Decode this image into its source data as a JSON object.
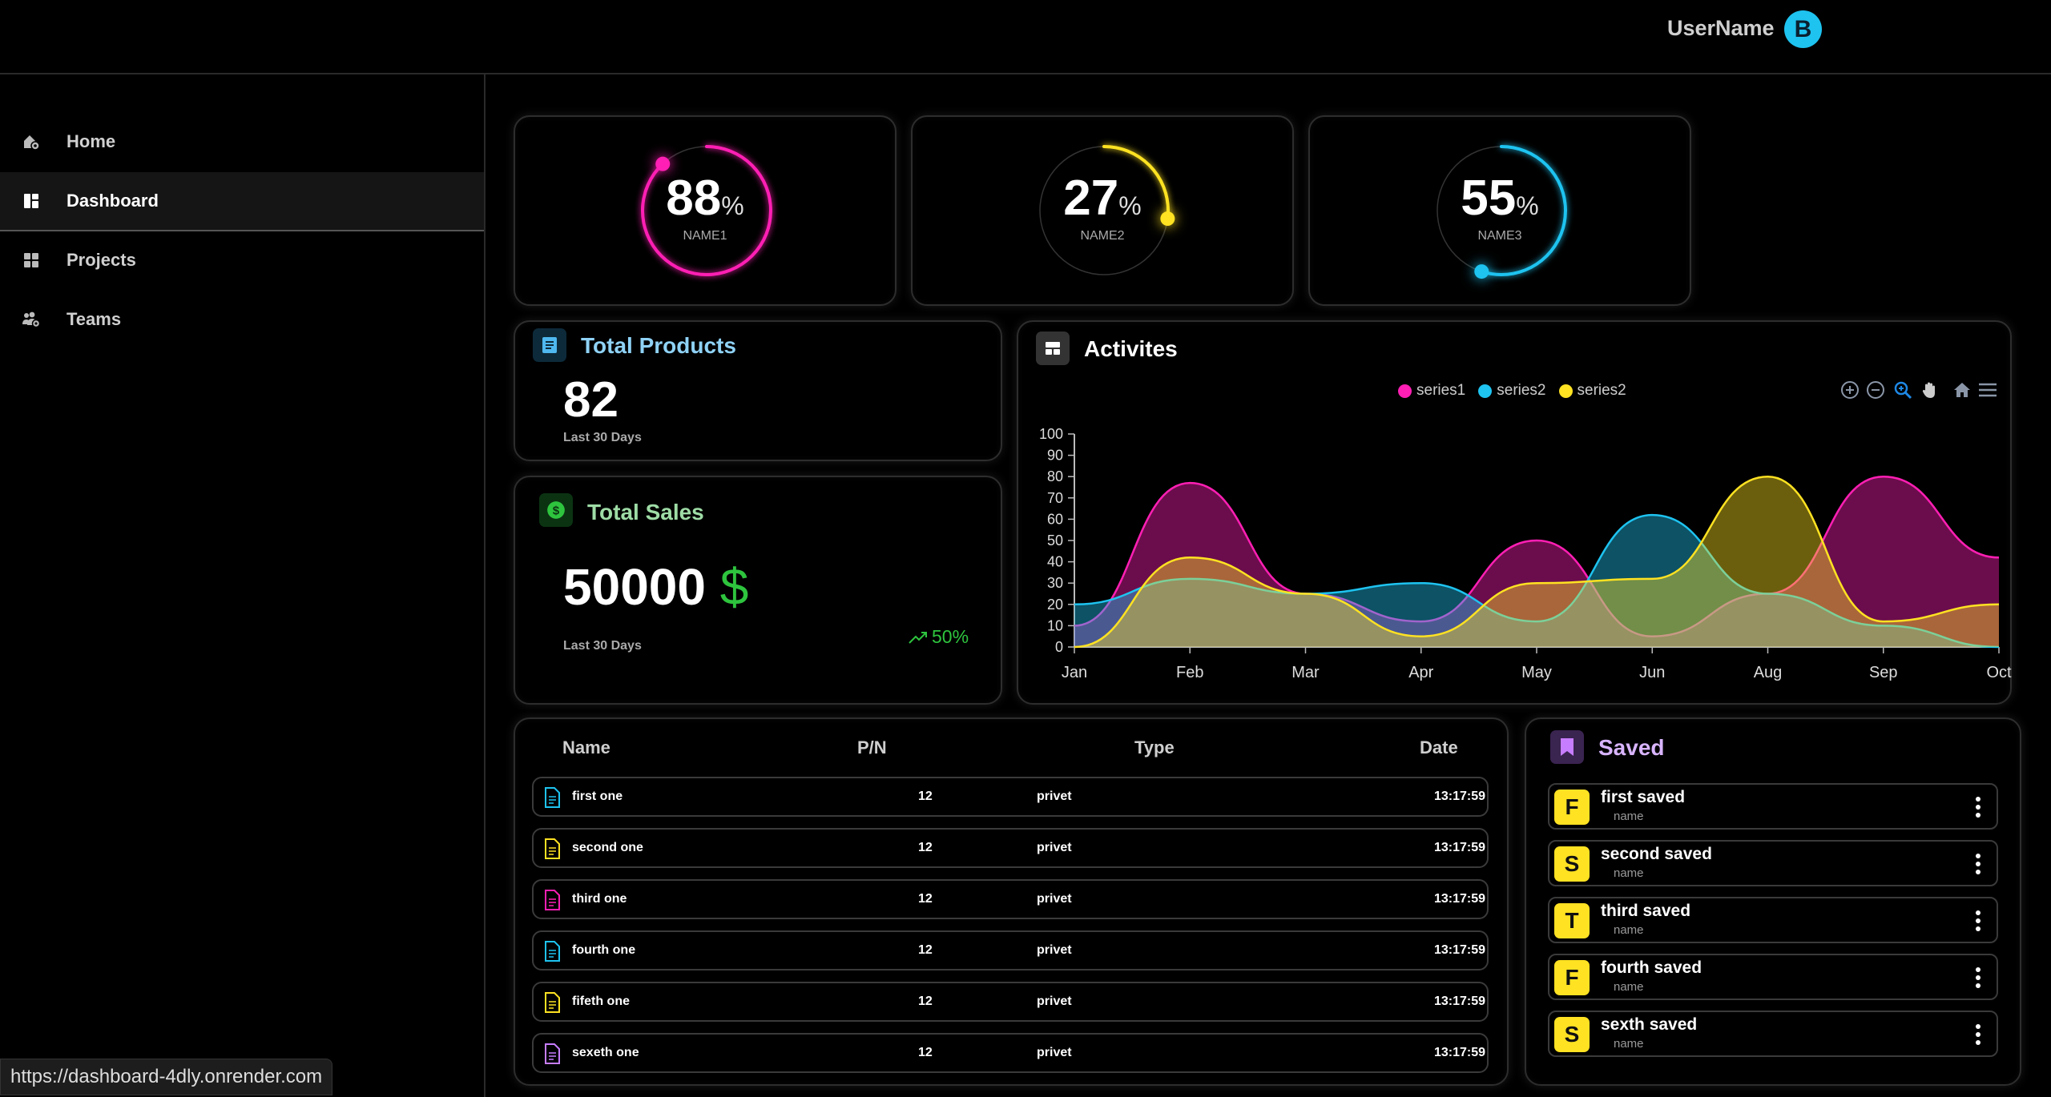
{
  "header": {
    "username": "UserName",
    "avatar_letter": "B"
  },
  "sidebar": {
    "items": [
      {
        "label": "Home",
        "icon": "home-settings-icon"
      },
      {
        "label": "Dashboard",
        "icon": "dashboard-icon",
        "active": true
      },
      {
        "label": "Projects",
        "icon": "grid-icon"
      },
      {
        "label": "Teams",
        "icon": "teams-icon"
      }
    ]
  },
  "gauges": [
    {
      "value": "88",
      "unit": "%",
      "name": "NAME1",
      "percent": 88,
      "color": "#ff1fb4"
    },
    {
      "value": "27",
      "unit": "%",
      "name": "NAME2",
      "percent": 27,
      "color": "#ffe222"
    },
    {
      "value": "55",
      "unit": "%",
      "name": "NAME3",
      "percent": 55,
      "color": "#1ec3f0"
    }
  ],
  "total_products": {
    "title": "Total Products",
    "value": "82",
    "period": "Last 30 Days",
    "accent": "#4fb8f0"
  },
  "total_sales": {
    "title": "Total Sales",
    "value": "50000",
    "currency": "$",
    "period": "Last 30 Days",
    "trend": "50%",
    "accent": "#2ec43e"
  },
  "activities": {
    "title": "Activites",
    "legend": [
      "series1",
      "series2",
      "series2"
    ],
    "toolbar": [
      "zoom-in-icon",
      "zoom-out-icon",
      "selection-zoom-icon",
      "pan-hand-icon",
      "reset-home-icon",
      "menu-icon"
    ]
  },
  "chart_data": {
    "type": "area",
    "categories": [
      "Jan",
      "Feb",
      "Mar",
      "Apr",
      "May",
      "Jun",
      "Aug",
      "Sep",
      "Oct"
    ],
    "series": [
      {
        "name": "series1",
        "values": [
          10,
          77,
          25,
          12,
          50,
          5,
          25,
          80,
          42
        ],
        "color": "#ff1fb4"
      },
      {
        "name": "series2",
        "values": [
          20,
          32,
          25,
          30,
          12,
          62,
          25,
          10,
          0
        ],
        "color": "#1ec3f0"
      },
      {
        "name": "series2",
        "values": [
          0,
          42,
          25,
          5,
          30,
          32,
          80,
          12,
          20
        ],
        "color": "#ffe222"
      }
    ],
    "ylim": [
      0,
      100
    ],
    "yticks": [
      0,
      10,
      20,
      30,
      40,
      50,
      60,
      70,
      80,
      90,
      100
    ],
    "legend_position": "top-center",
    "grid": false
  },
  "table": {
    "headers": [
      "Name",
      "P/N",
      "Type",
      "Date"
    ],
    "rows": [
      {
        "name": "first one",
        "pn": "12",
        "type": "privet",
        "date": "13:17:59",
        "icon_color": "#1ec3f0"
      },
      {
        "name": "second one",
        "pn": "12",
        "type": "privet",
        "date": "13:17:59",
        "icon_color": "#ffe222"
      },
      {
        "name": "third one",
        "pn": "12",
        "type": "privet",
        "date": "13:17:59",
        "icon_color": "#ff1fb4"
      },
      {
        "name": "fourth one",
        "pn": "12",
        "type": "privet",
        "date": "13:17:59",
        "icon_color": "#1ec3f0"
      },
      {
        "name": "fifeth one",
        "pn": "12",
        "type": "privet",
        "date": "13:17:59",
        "icon_color": "#ffe222"
      },
      {
        "name": "sexeth one",
        "pn": "12",
        "type": "privet",
        "date": "13:17:59",
        "icon_color": "#c77dff"
      }
    ]
  },
  "saved": {
    "title": "Saved",
    "accent": "#c77dff",
    "items": [
      {
        "letter": "F",
        "title": "first saved",
        "sub": "name"
      },
      {
        "letter": "S",
        "title": "second saved",
        "sub": "name"
      },
      {
        "letter": "T",
        "title": "third saved",
        "sub": "name"
      },
      {
        "letter": "F",
        "title": "fourth saved",
        "sub": "name"
      },
      {
        "letter": "S",
        "title": "sexth saved",
        "sub": "name"
      }
    ]
  },
  "statusbar": {
    "url": "https://dashboard-4dly.onrender.com"
  }
}
